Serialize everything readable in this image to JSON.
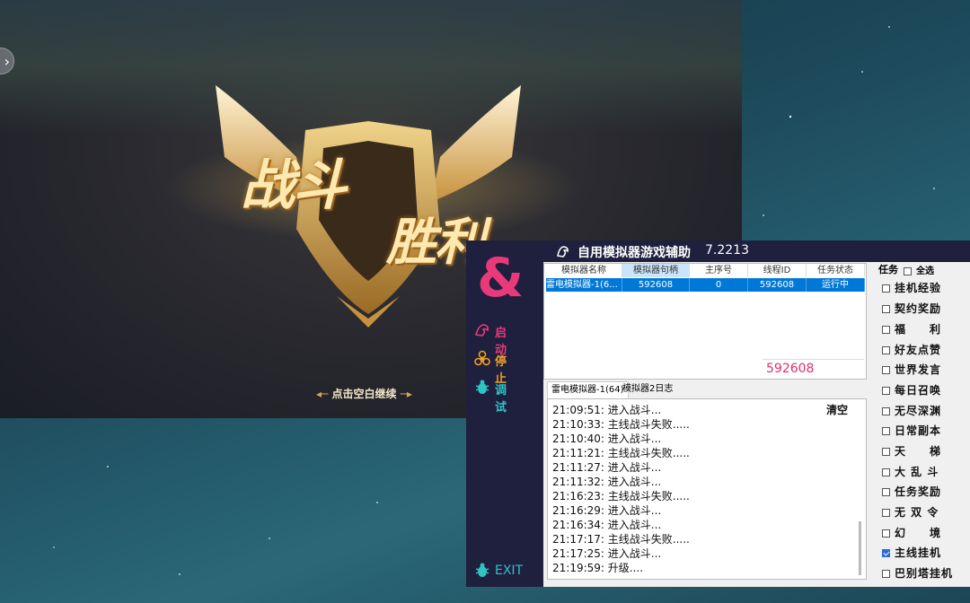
{
  "game": {
    "victory_line1": "战斗",
    "victory_line2": "胜利",
    "continue_hint": "点击空白继续"
  },
  "app": {
    "title": "自用模拟器游戏辅助",
    "version": "7.2213",
    "sidebar": {
      "start_label": "启动",
      "stop_label": "停止",
      "debug_label": "调试",
      "exit_label": "EXIT"
    },
    "table": {
      "headers": [
        "模拟器名称",
        "模拟器句柄",
        "主序号",
        "线程ID",
        "任务状态"
      ],
      "rows": [
        [
          "雷电模拟器-1(6...",
          "592608",
          "0",
          "592608",
          "运行中"
        ]
      ]
    },
    "handle_display": "592608",
    "tabs": [
      "雷电模拟器-1(64)",
      "模拟器2日志"
    ],
    "log_clear_label": "清空",
    "log": [
      "21:09:51:  进入战斗...",
      "21:10:33:  主线战斗失败.....",
      "21:10:40:  进入战斗...",
      "21:11:21:  主线战斗失败.....",
      "21:11:27:  进入战斗...",
      "21:11:32:  进入战斗...",
      "21:16:23:  主线战斗失败.....",
      "21:16:29:  进入战斗...",
      "21:16:34:  进入战斗...",
      "21:17:17:  主线战斗失败.....",
      "21:17:25:  进入战斗...",
      "21:19:59:  升级...."
    ],
    "tasks_header": "任务",
    "select_all_label": "全选",
    "tasks": [
      {
        "label": "挂机经验",
        "checked": false
      },
      {
        "label": "契约奖励",
        "checked": false
      },
      {
        "label": "福　　利",
        "checked": false
      },
      {
        "label": "好友点赞",
        "checked": false
      },
      {
        "label": "世界发言",
        "checked": false
      },
      {
        "label": "每日召唤",
        "checked": false
      },
      {
        "label": "无尽深渊",
        "checked": false
      },
      {
        "label": "日常副本",
        "checked": false
      },
      {
        "label": "天　　梯",
        "checked": false
      },
      {
        "label": "大 乱 斗",
        "checked": false
      },
      {
        "label": "任务奖励",
        "checked": false
      },
      {
        "label": "无 双 令",
        "checked": false
      },
      {
        "label": "幻　　境",
        "checked": false
      },
      {
        "label": "主线挂机",
        "checked": true
      },
      {
        "label": "巴别塔挂机",
        "checked": false
      }
    ],
    "colors": {
      "sidebar_bg": "#1f1f3e",
      "start_color": "#e83a7a",
      "stop_color": "#f0a020",
      "debug_color": "#2ec4c4",
      "selection_blue": "#0078d7"
    }
  }
}
